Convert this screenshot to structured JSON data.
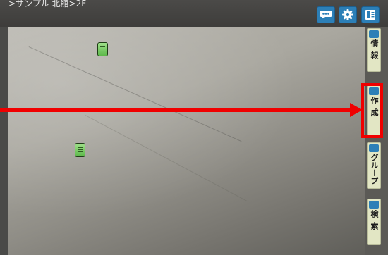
{
  "header": {
    "breadcrumb": ">サンプル 北館>2F",
    "icons": [
      "comment-icon",
      "gear-icon",
      "panel-icon"
    ],
    "accent_color": "#2c7fb7"
  },
  "side_tabs": [
    {
      "key": "info",
      "label": "情報",
      "icon": "document-icon"
    },
    {
      "key": "create",
      "label": "作成",
      "icon": "pin-edit-icon"
    },
    {
      "key": "group",
      "label": "グループ",
      "icon": "group-comment-icon"
    },
    {
      "key": "search",
      "label": "検索",
      "icon": "search-icon"
    }
  ],
  "markers": [
    {
      "kind": "document-marker",
      "color": "#6cc457"
    },
    {
      "kind": "document-marker",
      "color": "#6cc457"
    }
  ],
  "annotation": {
    "color": "#f00000",
    "target": "create"
  }
}
